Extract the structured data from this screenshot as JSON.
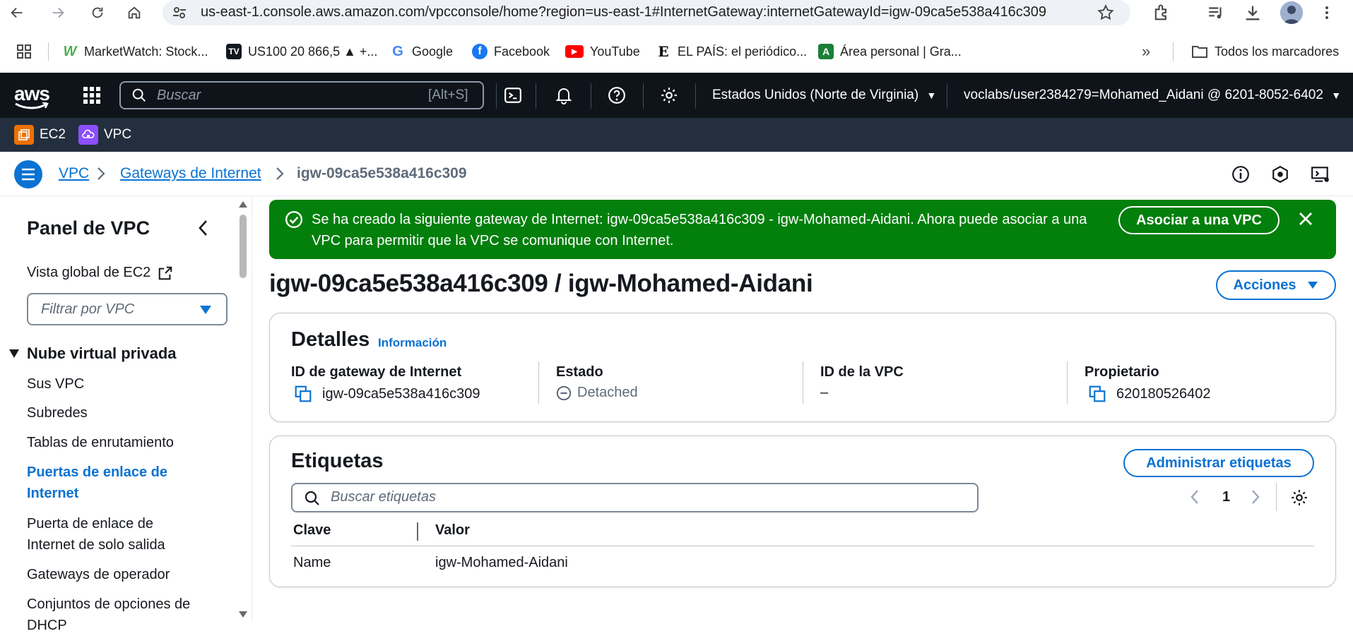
{
  "browser": {
    "url": "us-east-1.console.aws.amazon.com/vpcconsole/home?region=us-east-1#InternetGateway:internetGatewayId=igw-09ca5e538a416c309",
    "bookmarks": [
      {
        "label": "MarketWatch: Stock...",
        "icon": "marketwatch-icon",
        "color": "#4caf50"
      },
      {
        "label": "US100 20 866,5 ▲ +...",
        "icon": "tradingview-icon",
        "color": "#131722"
      },
      {
        "label": "Google",
        "icon": "google-icon",
        "color": "#4285f4"
      },
      {
        "label": "Facebook",
        "icon": "facebook-icon",
        "color": "#1877f2"
      },
      {
        "label": "YouTube",
        "icon": "youtube-icon",
        "color": "#ff0000"
      },
      {
        "label": "EL PAÍS: el periódico...",
        "icon": "elpais-icon",
        "color": "#000000"
      },
      {
        "label": "Área personal | Gra...",
        "icon": "area-personal-icon",
        "color": "#1a7f37"
      }
    ],
    "all_bookmarks": "Todos los marcadores"
  },
  "aws": {
    "logo": "aws",
    "search_placeholder": "Buscar",
    "search_shortcut": "[Alt+S]",
    "region": "Estados Unidos (Norte de Virginia)",
    "account": "voclabs/user2384279=Mohamed_Aidani @ 6201-8052-6402",
    "services": [
      {
        "label": "EC2",
        "color": "#ed7100"
      },
      {
        "label": "VPC",
        "color": "#8c4fff"
      }
    ]
  },
  "breadcrumb": {
    "root": "VPC",
    "parent": "Gateways de Internet",
    "current": "igw-09ca5e538a416c309"
  },
  "sidebar": {
    "title": "Panel de VPC",
    "ec2_global": "Vista global de EC2",
    "filter_placeholder": "Filtrar por VPC",
    "section": "Nube virtual privada",
    "items": [
      {
        "label": "Sus VPC",
        "active": false
      },
      {
        "label": "Subredes",
        "active": false
      },
      {
        "label": "Tablas de enrutamiento",
        "active": false
      },
      {
        "label": "Puertas de enlace de Internet",
        "active": true
      },
      {
        "label": "Puerta de enlace de Internet de solo salida",
        "active": false
      },
      {
        "label": "Gateways de operador",
        "active": false
      },
      {
        "label": "Conjuntos de opciones de DHCP",
        "active": false
      }
    ]
  },
  "flash": {
    "message": "Se ha creado la siguiente gateway de Internet: igw-09ca5e538a416c309 - igw-Mohamed-Aidani. Ahora puede asociar a una VPC para permitir que la VPC se comunique con Internet.",
    "action": "Asociar a una VPC",
    "color": "#037f0c"
  },
  "page": {
    "title": "igw-09ca5e538a416c309 / igw-Mohamed-Aidani",
    "actions": "Acciones"
  },
  "details": {
    "title": "Detalles",
    "info": "Información",
    "columns": [
      {
        "label": "ID de gateway de Internet",
        "value": "igw-09ca5e538a416c309"
      },
      {
        "label": "Estado",
        "value": "Detached"
      },
      {
        "label": "ID de la VPC",
        "value": "–"
      },
      {
        "label": "Propietario",
        "value": "620180526402"
      }
    ]
  },
  "tags": {
    "title": "Etiquetas",
    "manage": "Administrar etiquetas",
    "search_placeholder": "Buscar etiquetas",
    "page": "1",
    "headers": {
      "key": "Clave",
      "value": "Valor"
    },
    "rows": [
      {
        "key": "Name",
        "value": "igw-Mohamed-Aidani"
      }
    ]
  },
  "colors": {
    "accent": "#0972d3",
    "nav_bg": "#0f141a",
    "services_bg": "#232f3e"
  }
}
